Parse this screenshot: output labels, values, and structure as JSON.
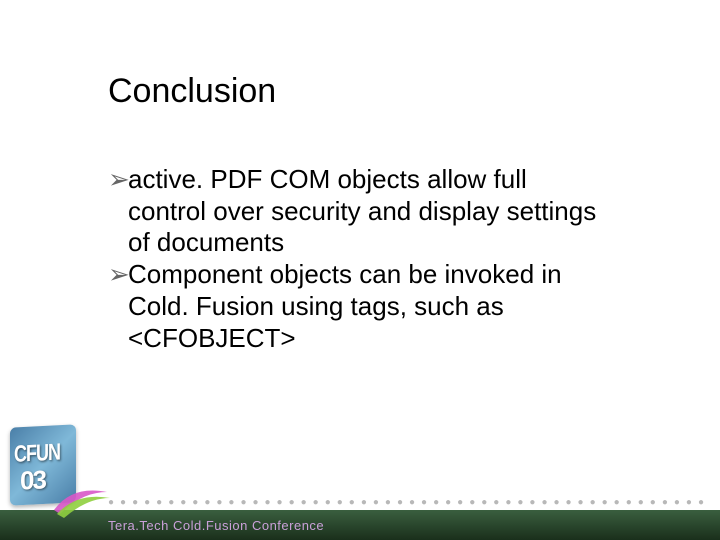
{
  "title": "Conclusion",
  "bullets": [
    "active. PDF COM objects allow full control over security and display settings of documents",
    "Component objects can be invoked in Cold. Fusion using tags, such as <CFOBJECT>"
  ],
  "footer_text": "Tera.Tech Cold.Fusion Conference",
  "logo": {
    "top_text": "CFUN",
    "bottom_text": "03"
  },
  "bullet_glyph": "➢"
}
